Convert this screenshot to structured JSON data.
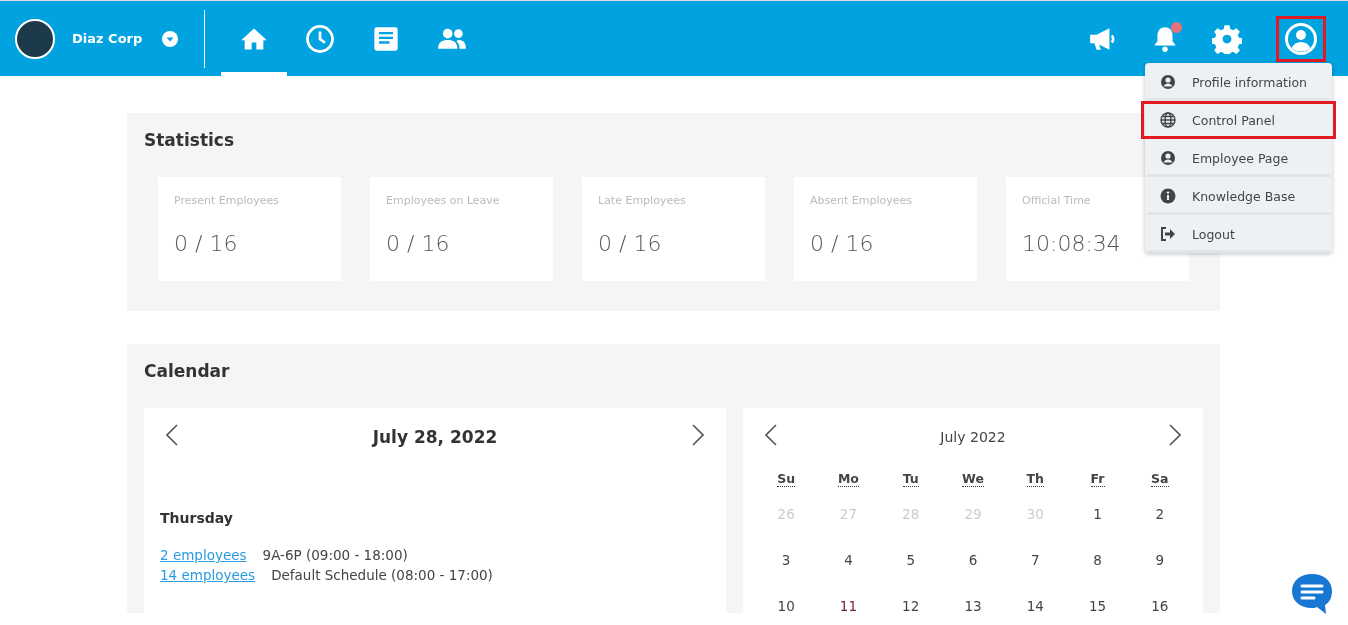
{
  "header": {
    "company": "Diaz Corp",
    "nav": [
      {
        "kind": "home",
        "selected": true
      },
      {
        "kind": "clock",
        "selected": false
      },
      {
        "kind": "document",
        "selected": false
      },
      {
        "kind": "people",
        "selected": false
      }
    ],
    "notification_unread": true,
    "profile_highlighted": true
  },
  "user_menu": {
    "items": [
      {
        "kind": "user",
        "label": "Profile information",
        "highlighted": false
      },
      {
        "kind": "globe",
        "label": "Control Panel",
        "highlighted": true
      },
      {
        "kind": "user",
        "label": "Employee Page",
        "highlighted": false
      },
      {
        "kind": "info",
        "label": "Knowledge Base",
        "highlighted": false
      },
      {
        "kind": "logout",
        "label": "Logout",
        "highlighted": false
      }
    ]
  },
  "statistics": {
    "title": "Statistics",
    "cards": [
      {
        "label": "Present Employees",
        "value": "0 / 16"
      },
      {
        "label": "Employees on Leave",
        "value": "0 / 16"
      },
      {
        "label": "Late Employees",
        "value": "0 / 16"
      },
      {
        "label": "Absent Employees",
        "value": "0 / 16"
      },
      {
        "label": "Official Time",
        "value": "10:08:34"
      }
    ]
  },
  "calendar": {
    "title": "Calendar",
    "day_view": {
      "date": "July 28, 2022",
      "weekday": "Thursday",
      "schedules": [
        {
          "link": "2 employees",
          "schedule": "9A-6P (09:00 - 18:00)"
        },
        {
          "link": "14 employees",
          "schedule": "Default Schedule (08:00 - 17:00)"
        }
      ]
    },
    "month_view": {
      "month": "July 2022",
      "weekdays": [
        "Su",
        "Mo",
        "Tu",
        "We",
        "Th",
        "Fr",
        "Sa"
      ],
      "weeks": [
        [
          {
            "day": "26",
            "kind": "outside"
          },
          {
            "day": "27",
            "kind": "outside"
          },
          {
            "day": "28",
            "kind": "outside"
          },
          {
            "day": "29",
            "kind": "outside"
          },
          {
            "day": "30",
            "kind": "outside"
          },
          {
            "day": "1",
            "kind": "normal"
          },
          {
            "day": "2",
            "kind": "normal"
          }
        ],
        [
          {
            "day": "3",
            "kind": "normal"
          },
          {
            "day": "4",
            "kind": "normal"
          },
          {
            "day": "5",
            "kind": "normal"
          },
          {
            "day": "6",
            "kind": "normal"
          },
          {
            "day": "7",
            "kind": "normal"
          },
          {
            "day": "8",
            "kind": "normal"
          },
          {
            "day": "9",
            "kind": "normal"
          }
        ],
        [
          {
            "day": "10",
            "kind": "normal"
          },
          {
            "day": "11",
            "kind": "marked"
          },
          {
            "day": "12",
            "kind": "normal"
          },
          {
            "day": "13",
            "kind": "normal"
          },
          {
            "day": "14",
            "kind": "normal"
          },
          {
            "day": "15",
            "kind": "normal"
          },
          {
            "day": "16",
            "kind": "normal"
          }
        ]
      ]
    }
  }
}
